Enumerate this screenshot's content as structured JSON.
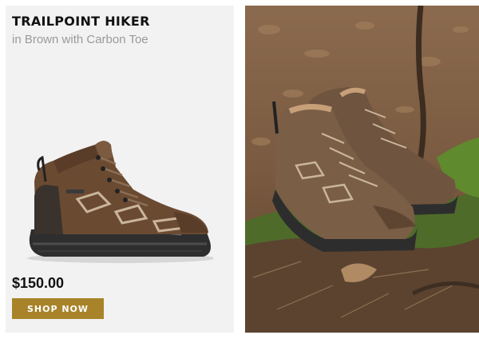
{
  "product": {
    "name": "TRAILPOINT HIKER",
    "variant": "in Brown with Carbon Toe",
    "price": "$150.00",
    "cta_label": "SHOP NOW"
  },
  "images": {
    "product_shot": "hiking-boot-side-view",
    "lifestyle_photo": "boots-on-mossy-forest-floor"
  },
  "colors": {
    "accent": "#a88329",
    "card_bg": "#f2f2f2",
    "title": "#111111",
    "subtitle": "#9a9a9a",
    "boot_leather": "#6b4a32",
    "sole": "#2e2e2e"
  }
}
